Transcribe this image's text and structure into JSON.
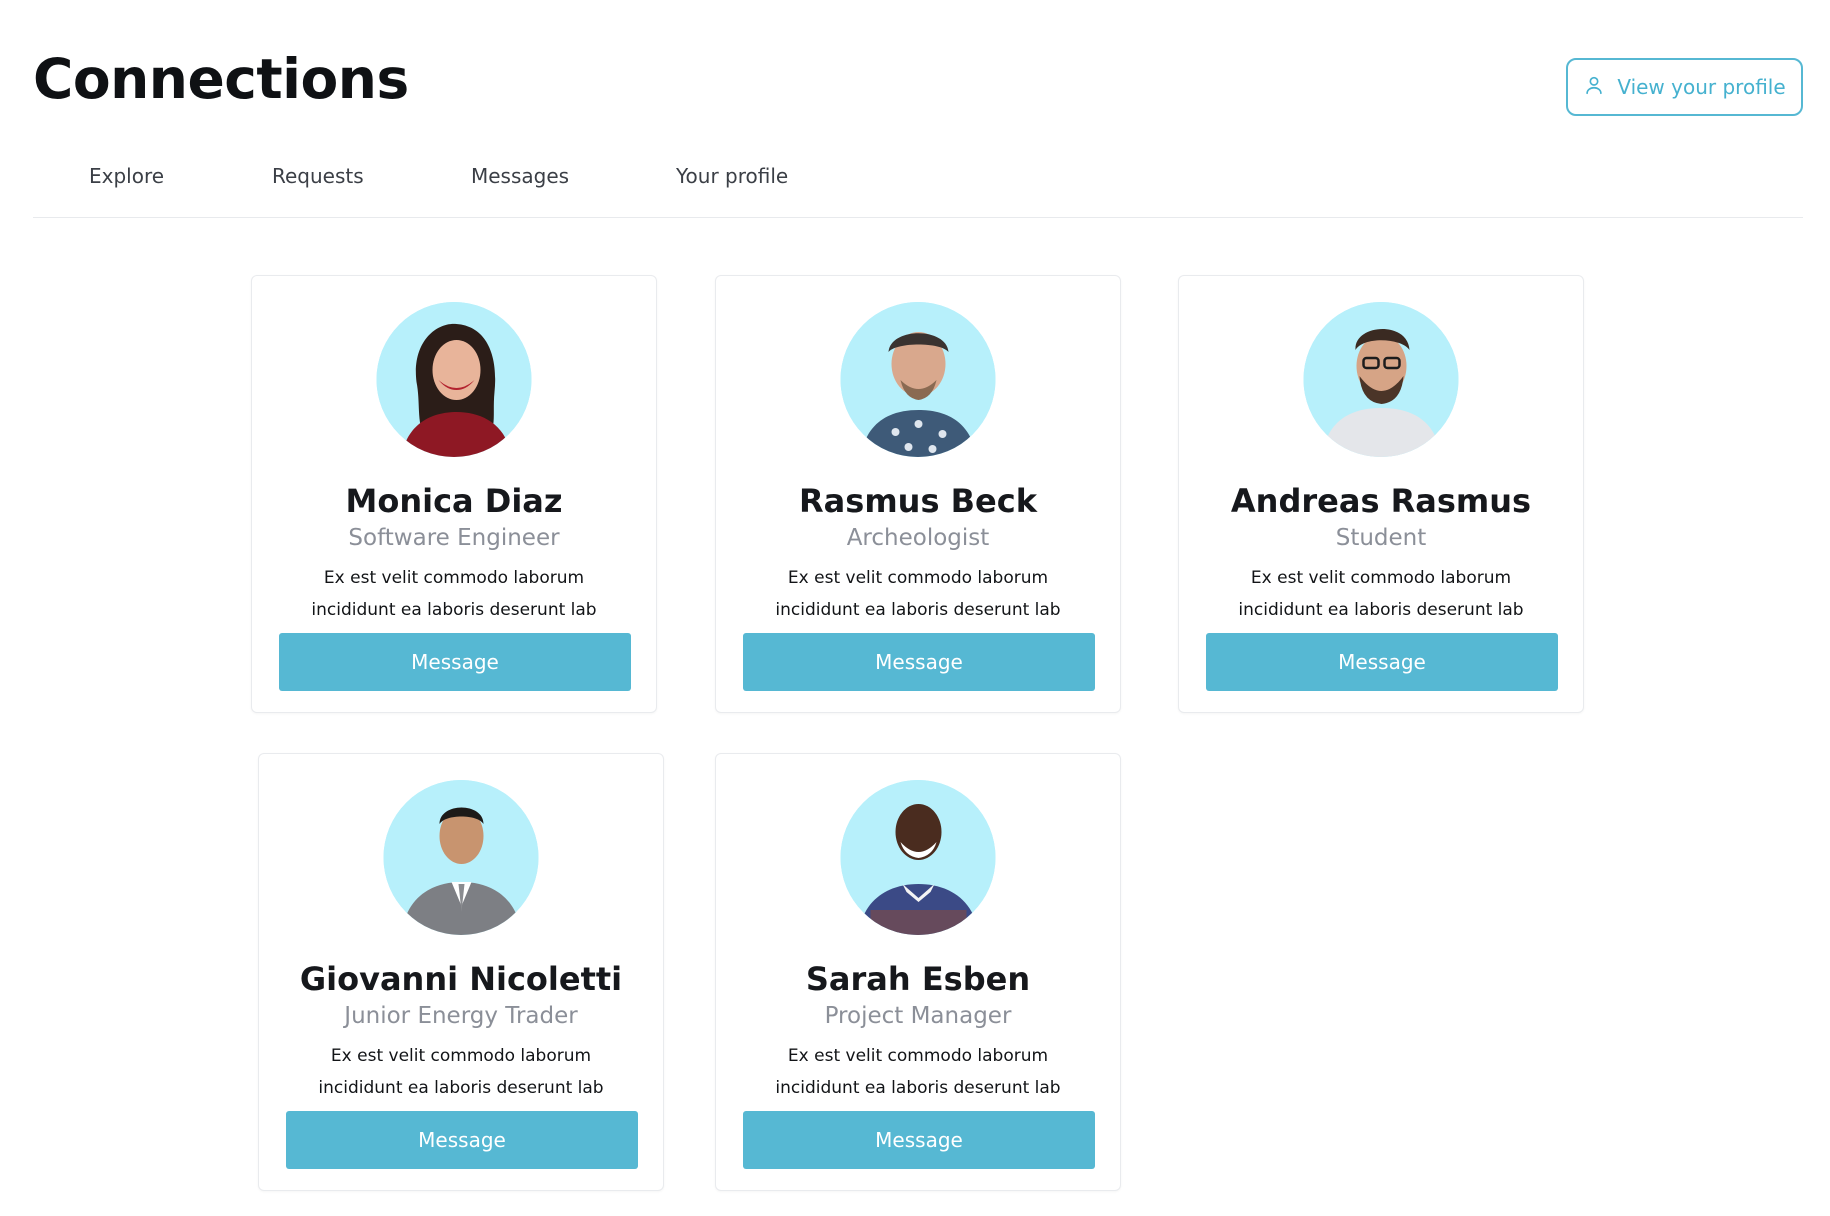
{
  "header": {
    "title": "Connections",
    "profile_button_label": "View your profile",
    "profile_button_icon": "user-icon"
  },
  "tabs": [
    {
      "label": "Explore"
    },
    {
      "label": "Requests"
    },
    {
      "label": "Messages"
    },
    {
      "label": "Your profile"
    }
  ],
  "colors": {
    "accent": "#56b8d3",
    "avatar_bg": "#b7f0fb",
    "muted_text": "#8b8f98"
  },
  "cards": [
    {
      "name": "Monica Diaz",
      "role": "Software Engineer",
      "description": "Ex est velit commodo laborum incididunt ea laboris deserunt lab",
      "button_label": "Message"
    },
    {
      "name": "Rasmus Beck",
      "role": "Archeologist",
      "description": "Ex est velit commodo laborum incididunt ea laboris deserunt lab",
      "button_label": "Message"
    },
    {
      "name": "Andreas Rasmus",
      "role": "Student",
      "description": "Ex est velit commodo laborum incididunt ea laboris deserunt lab",
      "button_label": "Message"
    },
    {
      "name": "Giovanni Nicoletti",
      "role": "Junior Energy Trader",
      "description": "Ex est velit commodo laborum incididunt ea laboris deserunt lab",
      "button_label": "Message"
    },
    {
      "name": "Sarah Esben",
      "role": "Project Manager",
      "description": "Ex est velit commodo laborum incididunt ea laboris deserunt lab",
      "button_label": "Message"
    }
  ]
}
